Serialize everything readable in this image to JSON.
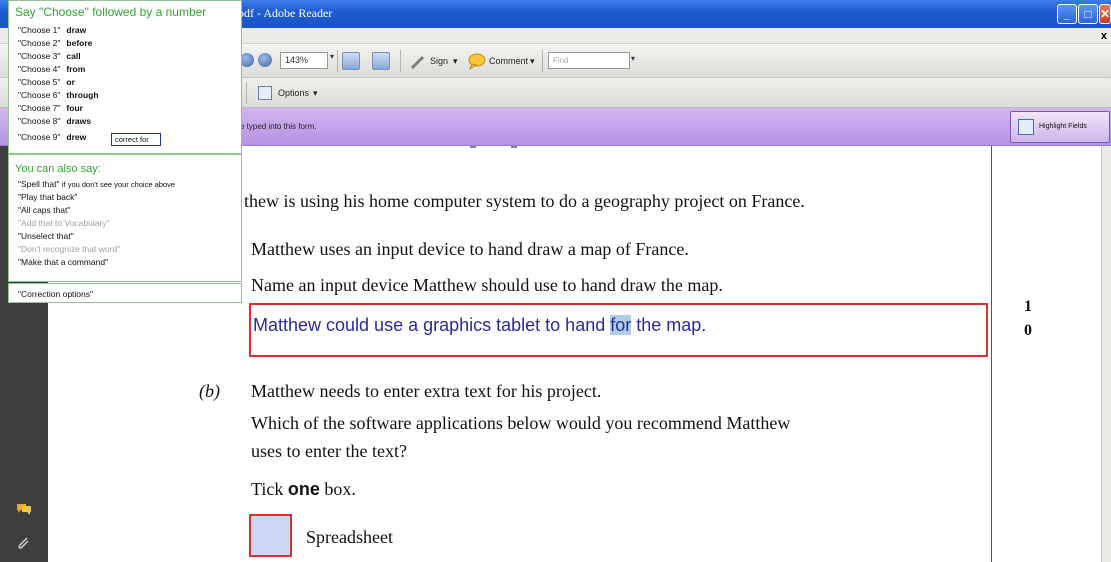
{
  "window": {
    "title": "pdf - Adobe Reader",
    "min_glyph": "_",
    "max_glyph": "□",
    "close_glyph": "✕",
    "menu_close": "x"
  },
  "toolbar": {
    "zoom": "143%",
    "sign_label": "Sign",
    "comment_label": "Comment",
    "find_placeholder": "Find",
    "options_label": "Options"
  },
  "formbar": {
    "message": "e typed into this form.",
    "highlight_label": "Highlight Fields"
  },
  "document": {
    "intro": "thew is using his home computer system to do a geography project on France.",
    "a_line1": "Matthew uses an input device to hand draw a map of France.",
    "a_line2": "Name an input device Matthew should use to hand draw the map.",
    "answer_before": "Matthew could use a graphics tablet to hand ",
    "answer_highlight": "for",
    "answer_after": " the map.",
    "marks_top": "1",
    "marks_bottom": "0",
    "b_label": "(b)",
    "b_line1": "Matthew needs to enter extra text for his project.",
    "b_line2": "Which of the software applications below would you recommend Matthew",
    "b_line3": "uses to enter the text?",
    "tick_before": "Tick ",
    "tick_bold": "one",
    "tick_after": " box.",
    "option1": "Spreadsheet"
  },
  "speech": {
    "header": "Say \"Choose\" followed by a number",
    "choices": [
      {
        "cmd": "\"Choose 1\"",
        "word": "draw"
      },
      {
        "cmd": "\"Choose 2\"",
        "word": "before"
      },
      {
        "cmd": "\"Choose 3\"",
        "word": "call"
      },
      {
        "cmd": "\"Choose 4\"",
        "word": "from"
      },
      {
        "cmd": "\"Choose 5\"",
        "word": "or"
      },
      {
        "cmd": "\"Choose 6\"",
        "word": "through"
      },
      {
        "cmd": "\"Choose 7\"",
        "word": "four"
      },
      {
        "cmd": "\"Choose 8\"",
        "word": "draws"
      },
      {
        "cmd": "\"Choose 9\"",
        "word": "drew"
      }
    ],
    "correct_label": "correct for",
    "also_header": "You can also say:",
    "also_items": [
      {
        "text": "\"Spell that\"",
        "extra": "if you don't see your choice above"
      },
      {
        "text": "\"Play that back\""
      },
      {
        "text": "\"All caps that\""
      },
      {
        "text": "\"Add that to Vocabulary\""
      },
      {
        "text": "\"Unselect that\""
      },
      {
        "text": "\"Don't recognize that word\""
      },
      {
        "text": "\"Make that a command\""
      }
    ],
    "correction_options": "\"Correction options\""
  },
  "colors": {
    "accent_green": "#35a335",
    "form_bar": "#c4a6ea",
    "answer_box": "#d93030",
    "answer_text": "#2a2aa0"
  }
}
